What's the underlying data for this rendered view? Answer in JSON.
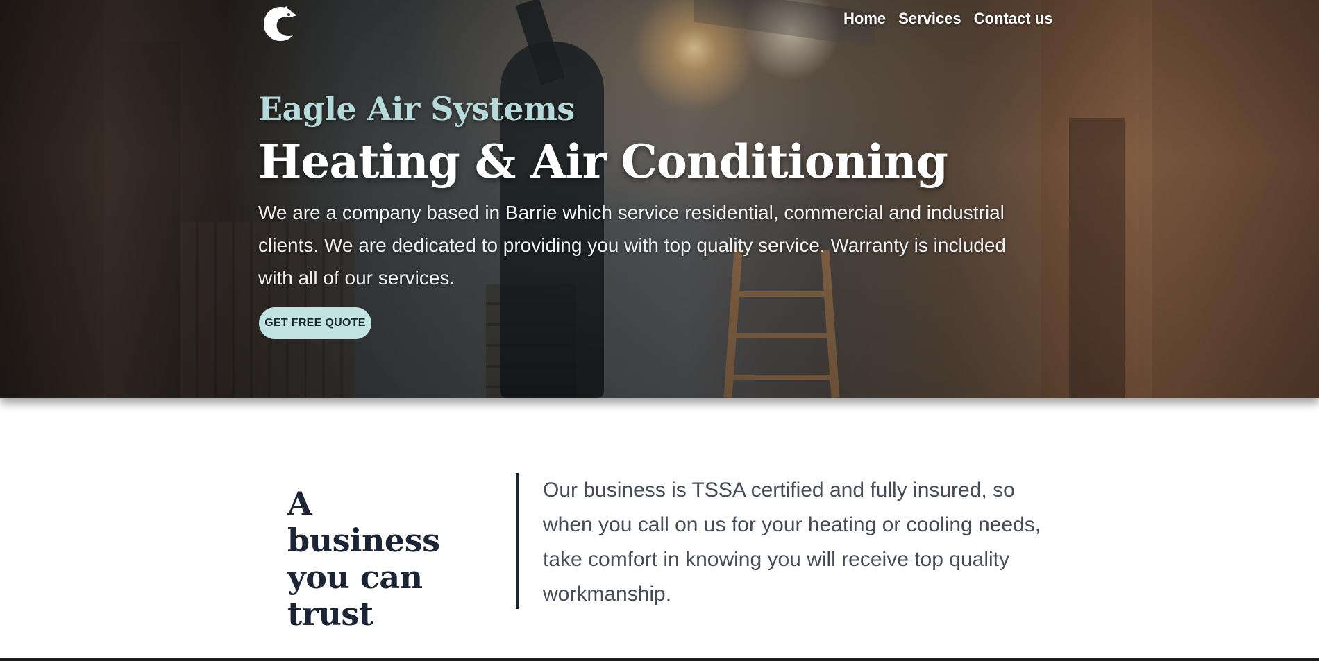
{
  "nav": {
    "items": [
      {
        "label": "Home"
      },
      {
        "label": "Services"
      },
      {
        "label": "Contact us"
      }
    ]
  },
  "hero": {
    "brand": "Eagle Air Systems",
    "headline": "Heating & Air Conditioning",
    "intro": "We are a company based in Barrie which service residential, commercial and industrial clients. We are dedicated to providing you with top quality service. Warranty is included with all of our services.",
    "cta_label": "GET FREE QUOTE"
  },
  "trust": {
    "title": "A business you can trust",
    "text": "Our business is TSSA certified and fully insured, so when you call on us for your heating or cooling needs, take comfort in knowing you will receive top quality workmanship."
  },
  "colors": {
    "brand_accent": "#b6dada",
    "cta_background": "#c1e3e1",
    "heading_dark": "#1c2535",
    "body_text": "#454c58"
  },
  "icons": {
    "logo": "eagle-head-logo"
  }
}
